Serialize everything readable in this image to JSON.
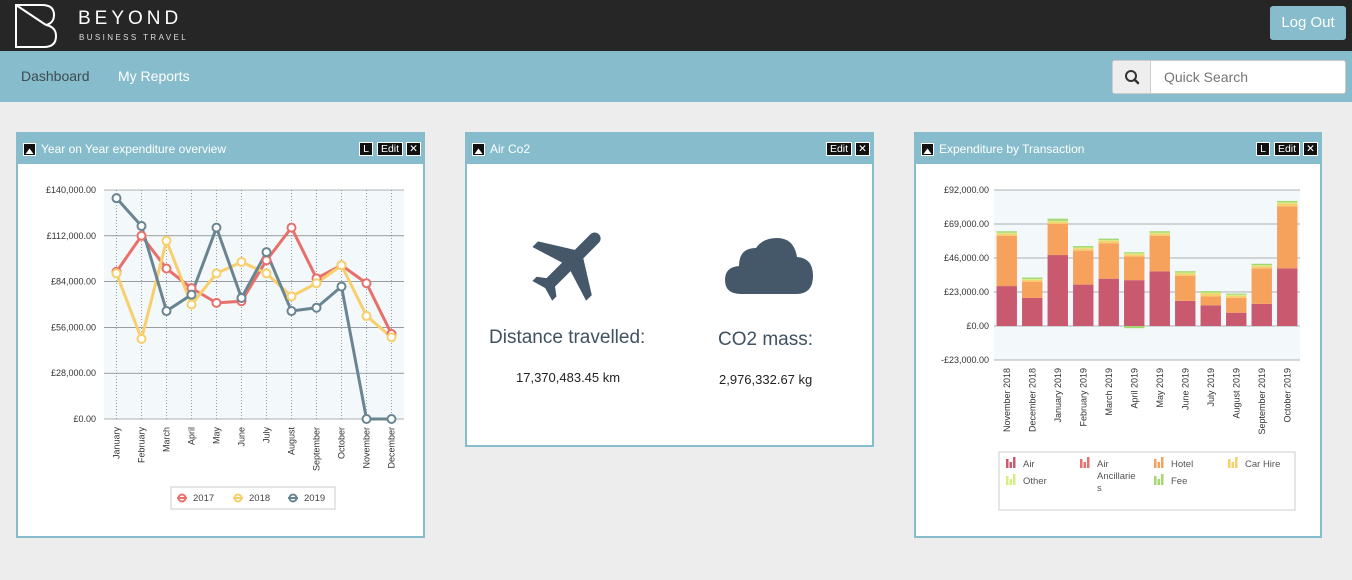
{
  "header": {
    "brand": "BEYOND",
    "tagline": "BUSINESS TRAVEL",
    "logout_label": "Log Out"
  },
  "nav": {
    "items": [
      {
        "label": "Dashboard"
      },
      {
        "label": "My Reports"
      }
    ],
    "search_placeholder": "Quick Search"
  },
  "widgets": {
    "yoy": {
      "title": "Year on Year expenditure overview",
      "l_label": "L",
      "edit_label": "Edit",
      "close_label": "✕"
    },
    "co2": {
      "title": "Air Co2",
      "edit_label": "Edit",
      "close_label": "✕",
      "distance_label": "Distance travelled:",
      "distance_value": "17,370,483.45 km",
      "mass_label": "CO2 mass:",
      "mass_value": "2,976,332.67 kg"
    },
    "transaction": {
      "title": "Expenditure by Transaction",
      "l_label": "L",
      "edit_label": "Edit",
      "close_label": "✕"
    }
  },
  "icons": [
    "logo-b-icon",
    "search-icon",
    "triangle-up-icon",
    "close-icon",
    "airplane-icon",
    "cloud-icon",
    "bar-chart-icon"
  ],
  "colors": {
    "accent": "#86bccb",
    "topbar": "#262626",
    "series_2017": "#e8706a",
    "series_2018": "#f7cf6c",
    "series_2019": "#6a8592",
    "air": "#c8596e",
    "air_ancillaries": "#e8706a",
    "hotel": "#f7a25c",
    "car_hire": "#f7cf6c",
    "other": "#d5ef82",
    "fee": "#a6d871"
  },
  "chart_data": [
    {
      "type": "line",
      "categories": [
        "January",
        "February",
        "March",
        "April",
        "May",
        "June",
        "July",
        "August",
        "September",
        "October",
        "November",
        "December"
      ],
      "ylim": [
        0,
        140000
      ],
      "yticks": [
        "£0.00",
        "£28,000.00",
        "£56,000.00",
        "£84,000.00",
        "£112,000.00",
        "£140,000.00"
      ],
      "ytick_values": [
        0,
        28000,
        56000,
        84000,
        112000,
        140000
      ],
      "series": [
        {
          "name": "2017",
          "values": [
            90000,
            112000,
            92000,
            80000,
            71000,
            72000,
            97000,
            117000,
            86000,
            94000,
            83000,
            52000
          ]
        },
        {
          "name": "2018",
          "values": [
            89000,
            49000,
            109000,
            70000,
            89000,
            96000,
            89000,
            75000,
            83000,
            94000,
            63000,
            50000
          ]
        },
        {
          "name": "2019",
          "values": [
            135000,
            118000,
            66000,
            76000,
            117000,
            74000,
            102000,
            66000,
            68000,
            81000,
            0,
            0
          ]
        }
      ],
      "grid": true,
      "legend": "bottom"
    },
    {
      "type": "bar",
      "stacked": true,
      "categories": [
        "November 2018",
        "December 2018",
        "January 2019",
        "February 2019",
        "March 2019",
        "April 2019",
        "May 2019",
        "June 2019",
        "July 2019",
        "August 2019",
        "September 2019",
        "October 2019"
      ],
      "ylim": [
        -23000,
        92000
      ],
      "yticks": [
        "-£23,000.00",
        "£0.00",
        "£23,000.00",
        "£46,000.00",
        "£69,000.00",
        "£92,000.00"
      ],
      "ytick_values": [
        -23000,
        0,
        23000,
        46000,
        69000,
        92000
      ],
      "series": [
        {
          "name": "Air",
          "values": [
            27000,
            19000,
            48000,
            28000,
            32000,
            31000,
            37000,
            17000,
            14000,
            9000,
            15000,
            39000
          ]
        },
        {
          "name": "Air Ancillaries",
          "values": [
            0,
            0,
            0,
            0,
            0,
            0,
            0,
            0,
            0,
            0,
            0,
            0
          ]
        },
        {
          "name": "Hotel",
          "values": [
            34000,
            11000,
            21000,
            23000,
            24000,
            16000,
            24000,
            17000,
            6000,
            10000,
            24000,
            42000
          ]
        },
        {
          "name": "Car Hire",
          "values": [
            1500,
            1200,
            1500,
            1500,
            1500,
            1500,
            1500,
            1500,
            2000,
            1500,
            1500,
            2000
          ]
        },
        {
          "name": "Other",
          "values": [
            600,
            600,
            600,
            600,
            600,
            600,
            600,
            600,
            600,
            600,
            600,
            600
          ]
        },
        {
          "name": "Fee",
          "values": [
            1000,
            1000,
            1500,
            1000,
            1000,
            800,
            1000,
            1000,
            1000,
            800,
            1000,
            1000
          ]
        }
      ],
      "negative": {
        "category": "April 2019",
        "value": -1500
      },
      "grid": true,
      "legend": "bottom"
    }
  ]
}
